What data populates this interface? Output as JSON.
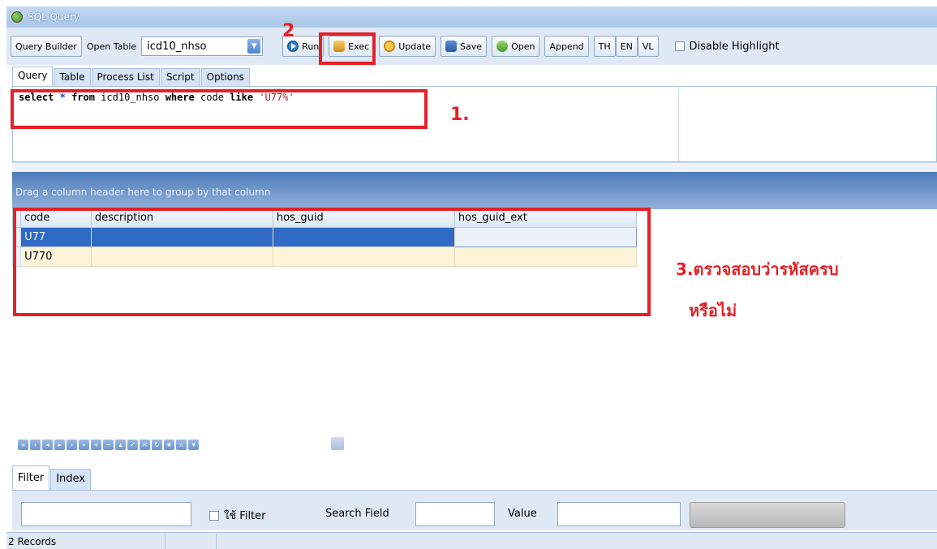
{
  "window": {
    "title": "SQL Query"
  },
  "toolbar": {
    "query_builder": "Query Builder",
    "open_table_label": "Open Table",
    "table_value": "icd10_nhso",
    "run": "Run",
    "exec": "Exec",
    "update": "Update",
    "save": "Save",
    "open": "Open",
    "append": "Append",
    "lang": [
      "TH",
      "EN",
      "VL"
    ],
    "disable_highlight": "Disable Highlight"
  },
  "query_tabs": [
    "Query",
    "Table",
    "Process List",
    "Script",
    "Options"
  ],
  "sql": {
    "kw_select": "select",
    "star": "*",
    "kw_from": "from",
    "table": "icd10_nhso",
    "kw_where": "where",
    "col": "code",
    "kw_like": "like",
    "pattern": "'U77%'"
  },
  "grid": {
    "group_hint": "Drag a column header here to group by that column",
    "columns": [
      "code",
      "description",
      "hos_guid",
      "hos_guid_ext"
    ],
    "rows": [
      [
        "U77",
        "",
        "",
        ""
      ],
      [
        "U770",
        "",
        "",
        ""
      ]
    ],
    "row_indicator": "I"
  },
  "filter_tabs": [
    "Filter",
    "Index"
  ],
  "filter": {
    "use_filter": "ใช้ Filter",
    "search_field_label": "Search Field",
    "value_label": "Value"
  },
  "status": {
    "records": "2 Records"
  },
  "annotations": {
    "step1": "1.",
    "step2": "2",
    "step3_line1": "3.ตรวจสอบว่ารหัสครบ",
    "step3_line2": "หรือไม่",
    "color": "#e52026"
  }
}
